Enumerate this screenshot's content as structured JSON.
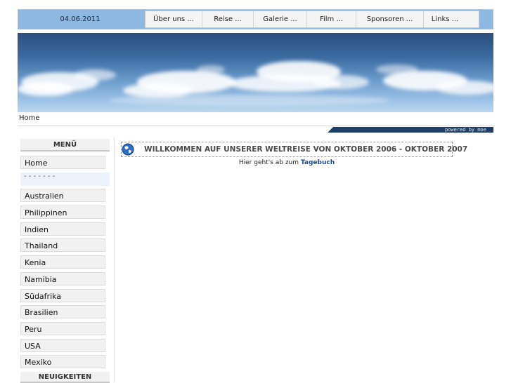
{
  "header": {
    "date": "04.06.2011"
  },
  "nav": {
    "items": [
      "Über uns ...",
      "Reise ...",
      "Galerie ...",
      "Film ...",
      "Sponsoren ...",
      "Links ..."
    ]
  },
  "breadcrumb": "Home",
  "powered_by": "powered by moe",
  "sidebar": {
    "menu_title": "MENÜ",
    "home": "Home",
    "divider": "- - - - - - -",
    "countries": [
      "Australien",
      "Philippinen",
      "Indien",
      "Thailand",
      "Kenia",
      "Namibia",
      "Südafrika",
      "Brasilien",
      "Peru",
      "USA",
      "Mexiko"
    ],
    "news_title": "NEUIGKEITEN"
  },
  "main": {
    "title": "WILLKOMMEN AUF UNSERER WELTREISE VON OKTOBER 2006 - OKTOBER 2007",
    "text_prefix": "Hier geht's ab zum",
    "link_label": "Tagebuch"
  },
  "colors": {
    "topbar": "#8fb8e0",
    "link": "#1a4d9c",
    "powered_bar": "#1f3f66"
  }
}
